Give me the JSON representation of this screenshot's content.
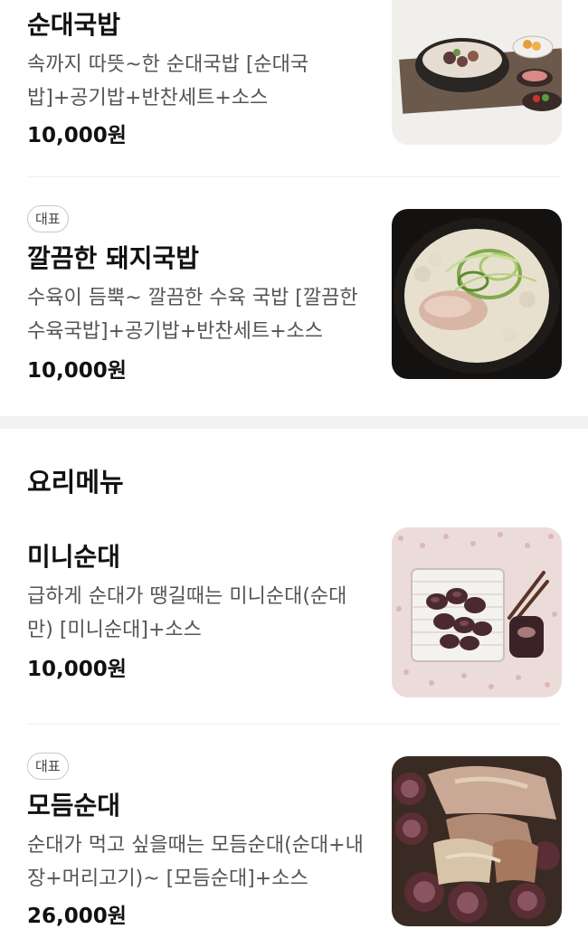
{
  "items": [
    {
      "name": "순대국밥",
      "desc": "속까지 따뜻~한 순대국밥 [순대국밥]+공기밥+반찬세트+소스",
      "price": "10,000원"
    },
    {
      "badge": "대표",
      "name": "깔끔한 돼지국밥",
      "desc": "수육이 듬뿍~ 깔끔한 수육 국밥 [깔끔한수육국밥]+공기밥+반찬세트+소스",
      "price": "10,000원"
    }
  ],
  "section": {
    "title": "요리메뉴"
  },
  "section_items": [
    {
      "name": "미니순대",
      "desc": "급하게 순대가 땡길때는 미니순대(순대만) [미니순대]+소스",
      "price": "10,000원"
    },
    {
      "badge": "대표",
      "name": "모듬순대",
      "desc": "순대가 먹고 싶을때는 모듬순대(순대+내장+머리고기)~ [모듬순대]+소스",
      "price": "26,000원"
    }
  ]
}
